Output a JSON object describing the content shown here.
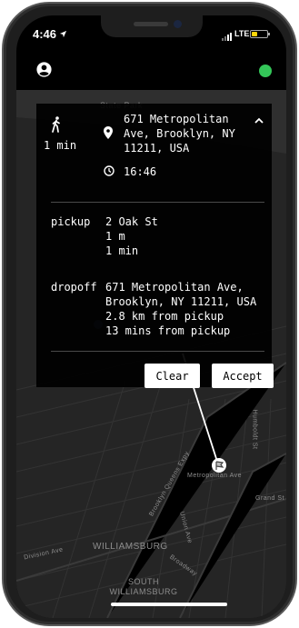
{
  "status": {
    "time": "4:46",
    "network": "LTE",
    "battery_fraction": 0.35,
    "battery_color": "#ffd60a"
  },
  "appbar": {
    "online_color": "#34c759",
    "account_icon": "account-circle-icon",
    "status_icon": "online-status-dot"
  },
  "card": {
    "eta": "1 min",
    "destination": "671 Metropolitan Ave, Brooklyn, NY 11211, USA",
    "time": "16:46",
    "pickup_label": "pickup",
    "pickup_address": "2 Oak St",
    "pickup_distance": "1 m",
    "pickup_time": "1 min",
    "dropoff_label": "dropoff",
    "dropoff_address_line1": "671 Metropolitan Ave,",
    "dropoff_address_line2": "Brooklyn, NY 11211, USA",
    "dropoff_distance": "2.8 km from pickup",
    "dropoff_time": "13 mins from pickup",
    "clear_label": "Clear",
    "accept_label": "Accept"
  },
  "map": {
    "labels": {
      "state_park": "State Park",
      "metropolitan": "Metropolitan Ave",
      "williamsburg": "WILLIAMSBURG",
      "south_williamsburg": "SOUTH WILLIAMSBURG",
      "division": "Division Ave",
      "broadway": "Broadway",
      "bqe": "Brooklyn Queens Expy",
      "union": "Union Ave",
      "grand": "Grand St",
      "humboldt": "Humboldt St"
    }
  }
}
